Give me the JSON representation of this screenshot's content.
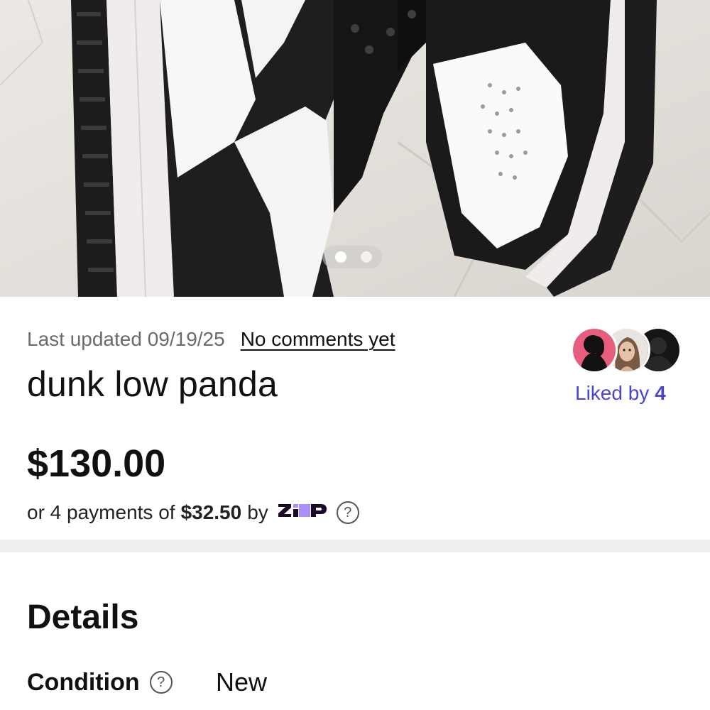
{
  "photo": {
    "carousel": {
      "slide_count": 2,
      "active_index": 0
    }
  },
  "listing": {
    "last_updated": "Last updated 09/19/25",
    "comments_link": "No comments yet",
    "title": "dunk low panda",
    "liked_by_label": "Liked by",
    "liked_by_count": "4",
    "price": "$130.00",
    "installments": {
      "prefix": "or 4 payments of",
      "amount": "$32.50",
      "by": "by",
      "provider": "zip",
      "help_icon": "question-circle-icon"
    }
  },
  "details": {
    "heading": "Details",
    "condition_label": "Condition",
    "condition_value": "New",
    "help_icon": "question-circle-icon"
  },
  "colors": {
    "liked_by_accent": "#4a45d1",
    "divider": "#eeeeef",
    "zip_purple": "#aa8fff",
    "zip_navy": "#1a0826"
  }
}
